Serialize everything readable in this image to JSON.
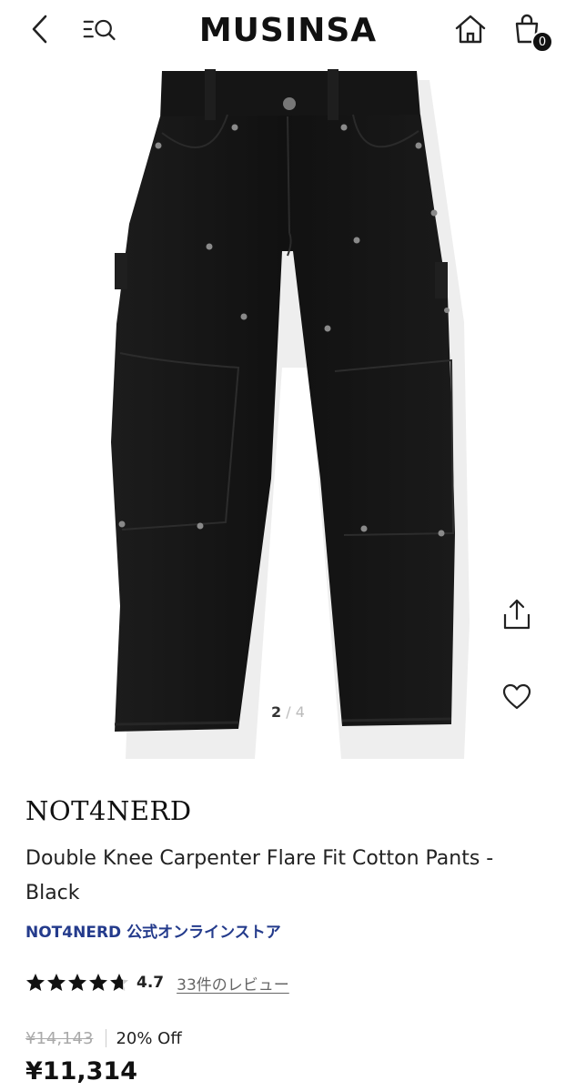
{
  "header": {
    "logo": "MUSINSA",
    "cart_count": "0",
    "icons": [
      "back-icon",
      "menu-search-icon",
      "home-icon",
      "cart-icon"
    ]
  },
  "gallery": {
    "current": "2",
    "separator": "/",
    "total": "4",
    "icons": [
      "share-icon",
      "heart-icon"
    ]
  },
  "product": {
    "brand": "NOT4NERD",
    "title": "Double Knee Carpenter Flare Fit Cotton Pants - Black",
    "store": "NOT4NERD 公式オンラインストア",
    "rating": "4.7",
    "stars": 4.7,
    "reviews": "33件のレビュー",
    "original_price": "¥14,143",
    "discount": "20% Off",
    "price": "¥11,314"
  },
  "colors": {
    "store_link": "#243b8c",
    "text": "#111111"
  }
}
